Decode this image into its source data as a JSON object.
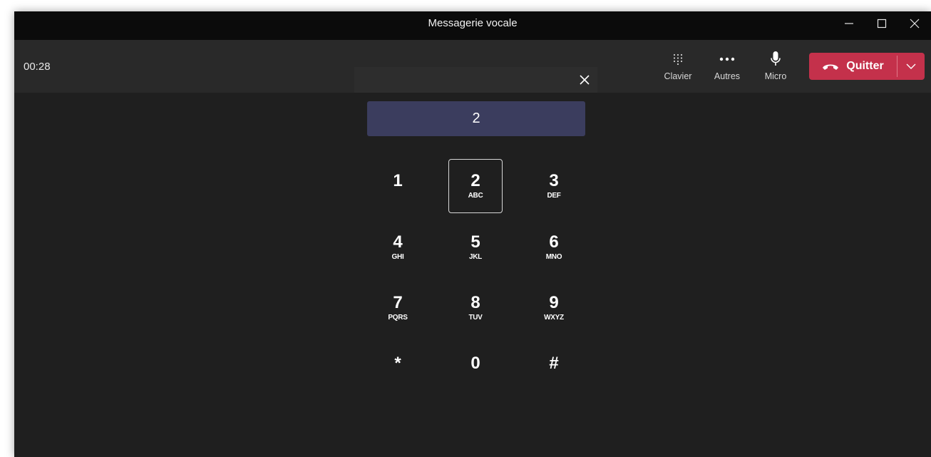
{
  "window": {
    "title": "Messagerie vocale"
  },
  "call": {
    "timer": "00:28"
  },
  "toolbar": {
    "dialpad_label": "Clavier",
    "more_label": "Autres",
    "mic_label": "Micro",
    "leave_label": "Quitter"
  },
  "dialpad": {
    "display_value": "2",
    "keys": [
      {
        "digit": "1",
        "letters": ""
      },
      {
        "digit": "2",
        "letters": "ABC"
      },
      {
        "digit": "3",
        "letters": "DEF"
      },
      {
        "digit": "4",
        "letters": "GHI"
      },
      {
        "digit": "5",
        "letters": "JKL"
      },
      {
        "digit": "6",
        "letters": "MNO"
      },
      {
        "digit": "7",
        "letters": "PQRS"
      },
      {
        "digit": "8",
        "letters": "TUV"
      },
      {
        "digit": "9",
        "letters": "WXYZ"
      },
      {
        "digit": "*",
        "letters": ""
      },
      {
        "digit": "0",
        "letters": ""
      },
      {
        "digit": "#",
        "letters": ""
      }
    ]
  },
  "icons": {
    "minimize": "minimize-icon",
    "maximize": "maximize-icon",
    "close": "close-icon",
    "dialpad": "dialpad-icon",
    "more": "more-icon",
    "mic": "microphone-icon",
    "hangup": "phone-hangup-icon",
    "chevron": "chevron-down-icon"
  },
  "colors": {
    "leave": "#c4314b",
    "display": "#3b3d5e",
    "background": "#1f1f1f"
  }
}
